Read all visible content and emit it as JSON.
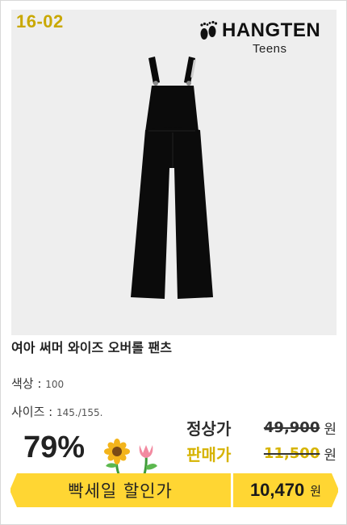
{
  "product": {
    "code": "16-02",
    "brand_name": "HANGTEN",
    "brand_sub": "Teens",
    "title": "여아 써머 와이즈 오버롤 팬츠",
    "color_label": "색상 :",
    "color_value": "100",
    "size_label": "사이즈 :",
    "size_value": "145./155."
  },
  "pricing": {
    "discount": "79%",
    "list_label": "정상가",
    "list_price": "49,900",
    "list_unit": "원",
    "sale_label": "판매가",
    "sale_price": "11,500",
    "sale_unit": "원"
  },
  "banner": {
    "label": "빡세일 할인가",
    "price": "10,470",
    "unit": "원"
  },
  "colors": {
    "accent_yellow": "#ffd633",
    "sale_text": "#d6b300",
    "photo_bg": "#eeeeee",
    "garment": "#0b0b0b"
  },
  "icons": [
    "footprint-icon",
    "sunflower-icon",
    "tulip-icon"
  ]
}
